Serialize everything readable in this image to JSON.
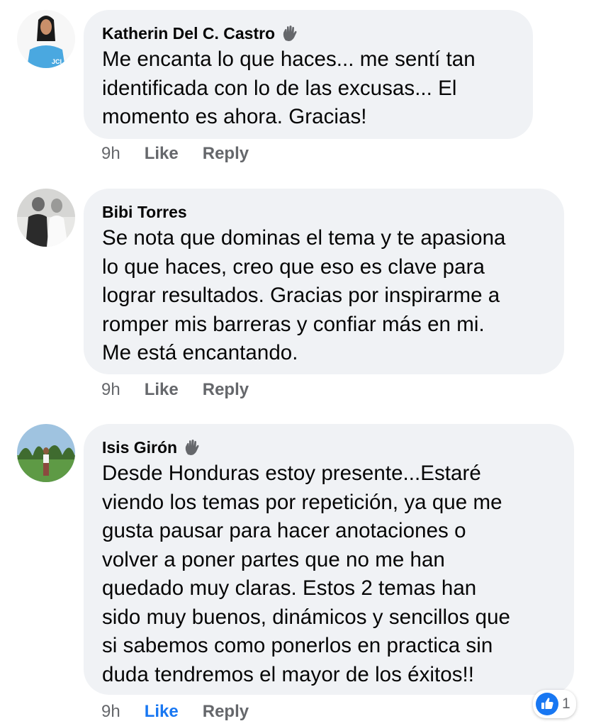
{
  "comments": [
    {
      "author": "Katherin Del C. Castro",
      "badge_icon": "waving-hand-icon",
      "text": "Me encanta lo que haces... me sentí tan\nidentificada con lo de las excusas... El\nmomento es ahora. Gracias!",
      "avatar_text": "JCI",
      "time": "9h",
      "like_label": "Like",
      "reply_label": "Reply"
    },
    {
      "author": "Bibi Torres",
      "text": "Se nota que dominas el tema y te apasiona\nlo que haces, creo que eso es clave para\nlograr resultados. Gracias por inspirarme a\nromper mis barreras y confiar más en mi.\nMe está encantando.",
      "time": "9h",
      "like_label": "Like",
      "reply_label": "Reply"
    },
    {
      "author": "Isis Girón",
      "badge_icon": "waving-hand-icon",
      "text": "Desde Honduras estoy presente...Estaré\nviendo los temas por repetición, ya que me\ngusta pausar para hacer anotaciones o\nvolver a poner partes que no me han\nquedado muy claras. Estos  2 temas han\nsido muy buenos, dinámicos y sencillos que\nsi sabemos como ponerlos en practica sin\nduda tendremos el mayor de los éxitos!!",
      "time": "9h",
      "like_label": "Like",
      "liked": true,
      "reply_label": "Reply",
      "reaction_icon": "thumbs-up-icon",
      "reaction_count": "1"
    }
  ],
  "colors": {
    "bubble": "#f0f2f5",
    "meta_text": "#65676b",
    "like_active": "#1877f2"
  }
}
